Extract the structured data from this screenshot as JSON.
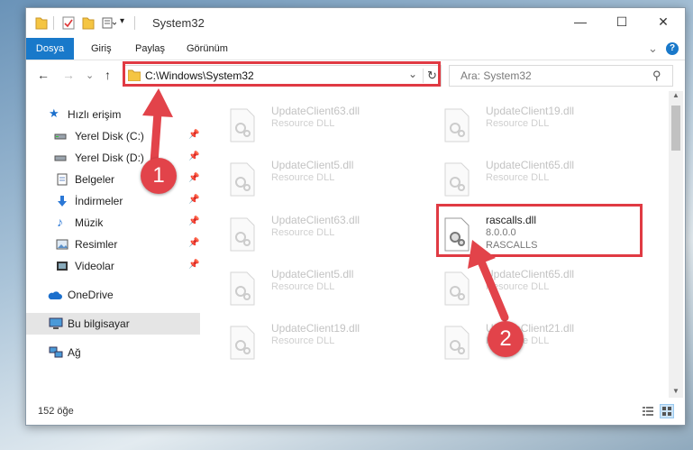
{
  "window": {
    "title": "System32",
    "minimize": "—",
    "maximize": "☐",
    "close": "✕"
  },
  "ribbon": {
    "tabs": [
      "Dosya",
      "Giriş",
      "Paylaş",
      "Görünüm"
    ],
    "collapse": "⌄",
    "help": "?"
  },
  "nav": {
    "back": "←",
    "forward": "→",
    "recent": "⌄",
    "up": "↑",
    "address": "C:\\Windows\\System32",
    "address_dropdown": "⌄",
    "refresh": "↻",
    "search_placeholder": "Ara: System32",
    "search_icon": "⚲"
  },
  "sidebar": {
    "items": [
      {
        "label": "Hızlı erişim",
        "icon": "star-icon"
      },
      {
        "label": "Yerel Disk (C:)",
        "icon": "drive-icon",
        "pinned": true
      },
      {
        "label": "Yerel Disk (D:)",
        "icon": "drive-icon",
        "pinned": true
      },
      {
        "label": "Belgeler",
        "icon": "documents-icon",
        "pinned": true
      },
      {
        "label": "İndirmeler",
        "icon": "downloads-icon",
        "pinned": true
      },
      {
        "label": "Müzik",
        "icon": "music-icon",
        "pinned": true
      },
      {
        "label": "Resimler",
        "icon": "pictures-icon",
        "pinned": true
      },
      {
        "label": "Videolar",
        "icon": "videos-icon",
        "pinned": true
      },
      {
        "label": "OneDrive",
        "icon": "cloud-icon"
      },
      {
        "label": "Bu bilgisayar",
        "icon": "computer-icon",
        "selected": true
      },
      {
        "label": "Ağ",
        "icon": "network-icon"
      }
    ],
    "pin_glyph": "📌"
  },
  "files": [
    {
      "name": "UpdateClient63.dll",
      "desc": "Resource DLL"
    },
    {
      "name": "UpdateClient19.dll",
      "desc": "Resource DLL"
    },
    {
      "name": "UpdateClient5.dll",
      "desc": "Resource DLL"
    },
    {
      "name": "UpdateClient65.dll",
      "desc": "Resource DLL"
    },
    {
      "name": "UpdateClient63.dll",
      "desc": "Resource DLL"
    },
    {
      "name": "rascalls.dll",
      "version": "8.0.0.0",
      "desc": "RASCALLS",
      "highlighted": true
    },
    {
      "name": "UpdateClient5.dll",
      "desc": "Resource DLL"
    },
    {
      "name": "UpdateClient65.dll",
      "desc": "Resource DLL"
    },
    {
      "name": "UpdateClient19.dll",
      "desc": "Resource DLL"
    },
    {
      "name": "UpdateClient21.dll",
      "desc": "Resource DLL"
    }
  ],
  "status": {
    "count": "152 öğe"
  },
  "annotations": {
    "step1": "1",
    "step2": "2",
    "color": "#e03a43"
  }
}
